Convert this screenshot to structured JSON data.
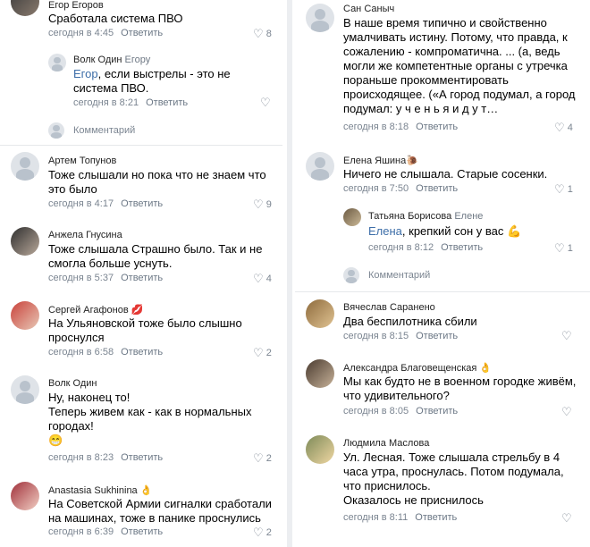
{
  "left": {
    "c1": {
      "author": "Егор Егоров",
      "text": "Сработала система ПВО",
      "time": "сегодня в 4:45",
      "reply": "Ответить",
      "likes": "8"
    },
    "r1": {
      "author": "Волк Один",
      "reply_to": "Егору",
      "mention": "Егор",
      "text": ", если выстрелы - это не система ПВО.",
      "time": "сегодня в 8:21",
      "reply": "Ответить",
      "likes": ""
    },
    "add1": "Комментарий",
    "c2": {
      "author": "Артем Топунов",
      "text": "Тоже слышали но пока что не знаем что это было",
      "time": "сегодня в 4:17",
      "reply": "Ответить",
      "likes": "9"
    },
    "c3": {
      "author": "Анжела Гнусина",
      "text": "Тоже слышала Страшно было. Так и не смогла больше уснуть.",
      "time": "сегодня в 5:37",
      "reply": "Ответить",
      "likes": "4"
    },
    "c4": {
      "author": "Сергей Агафонов",
      "badge": "💋",
      "text": "На Ульяновской тоже было слышно проснулся",
      "time": "сегодня в 6:58",
      "reply": "Ответить",
      "likes": "2"
    },
    "c5": {
      "author": "Волк Один",
      "line1": "Ну, наконец то!",
      "line2": "Теперь живем как - как в нормальных городах!",
      "emoji": "😁",
      "time": "сегодня в 8:23",
      "reply": "Ответить",
      "likes": "2"
    },
    "c6": {
      "author": "Anastasia Sukhinina",
      "badge": "👌",
      "text": "На Советской Армии сигналки сработали на машинах, тоже в панике проснулись",
      "time": "сегодня в 6:39",
      "reply": "Ответить",
      "likes": "2"
    }
  },
  "right": {
    "c1": {
      "author": "Сан Саныч",
      "text": "В наше время типично и свойственно умалчивать истину. Потому, что правда, к сожалению - компроматична. ... (а, ведь могли же компетентные органы с утречка пораньше прокомментировать происходящее. («А город подумал, а город подумал: у ч е н ь я    и д у т…",
      "time": "сегодня в 8:18",
      "reply": "Ответить",
      "likes": "4"
    },
    "c2": {
      "author": "Елена Яшина",
      "badge": "🐌",
      "text": "Ничего не слышала. Старые  сосенки.",
      "time": "сегодня в 7:50",
      "reply": "Ответить",
      "likes": "1"
    },
    "r2": {
      "author": "Татьяна Борисова",
      "reply_to": "Елене",
      "mention": "Елена",
      "text": ", крепкий сон у вас",
      "emoji": "💪",
      "time": "сегодня в 8:12",
      "reply": "Ответить",
      "likes": "1"
    },
    "add2": "Комментарий",
    "c3": {
      "author": "Вячеслав Саранено",
      "text": "Два беспилотника сбили",
      "time": "сегодня в 8:15",
      "reply": "Ответить",
      "likes": ""
    },
    "c4": {
      "author": "Александра Благовещенская",
      "badge": "👌",
      "text": "Мы как будто не в военном городке живём, что удивительного?",
      "time": "сегодня в 8:05",
      "reply": "Ответить",
      "likes": ""
    },
    "c5": {
      "author": "Людмила Маслова",
      "text": "Ул. Лесная. Тоже слышала стрельбу в 4 часа утра, проснулась. Потом подумала, что приснилось.",
      "line2": "Оказалось не приснилось",
      "time": "сегодня в 8:11",
      "reply": "Ответить",
      "likes": ""
    }
  },
  "icons": {
    "like": "heart-outline-icon",
    "avatar_placeholder": "user-silhouette-icon"
  },
  "colors": {
    "link": "#3d6ea8",
    "meta": "#7b8591",
    "divider": "#eceef1"
  }
}
